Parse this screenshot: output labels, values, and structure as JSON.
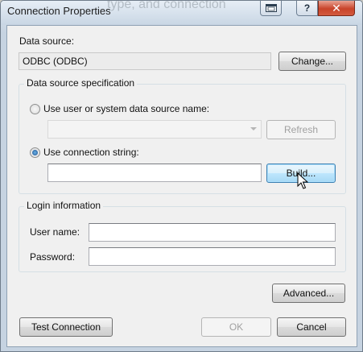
{
  "window": {
    "title": "Connection Properties",
    "background_title_fragment": "type, and connection",
    "caption": {
      "restore_icon": "window-restore-icon",
      "help_label": "?",
      "close_label": "✕"
    }
  },
  "data_source": {
    "label": "Data source:",
    "value": "ODBC (ODBC)",
    "change_button": "Change..."
  },
  "spec": {
    "group_title": "Data source specification",
    "use_dsn_label": "Use user or system data source name:",
    "dsn_selected": "",
    "refresh_button": "Refresh",
    "use_connstr_label": "Use connection string:",
    "connstr_value": "",
    "build_button": "Build...",
    "selected_option": "connection-string"
  },
  "login": {
    "group_title": "Login information",
    "username_label": "User name:",
    "username_value": "",
    "password_label": "Password:",
    "password_value": ""
  },
  "advanced_button": "Advanced...",
  "footer": {
    "test_button": "Test Connection",
    "ok_button": "OK",
    "cancel_button": "Cancel"
  },
  "colors": {
    "accent_hover": "#3c7fb1",
    "close_button": "#c8432a"
  }
}
